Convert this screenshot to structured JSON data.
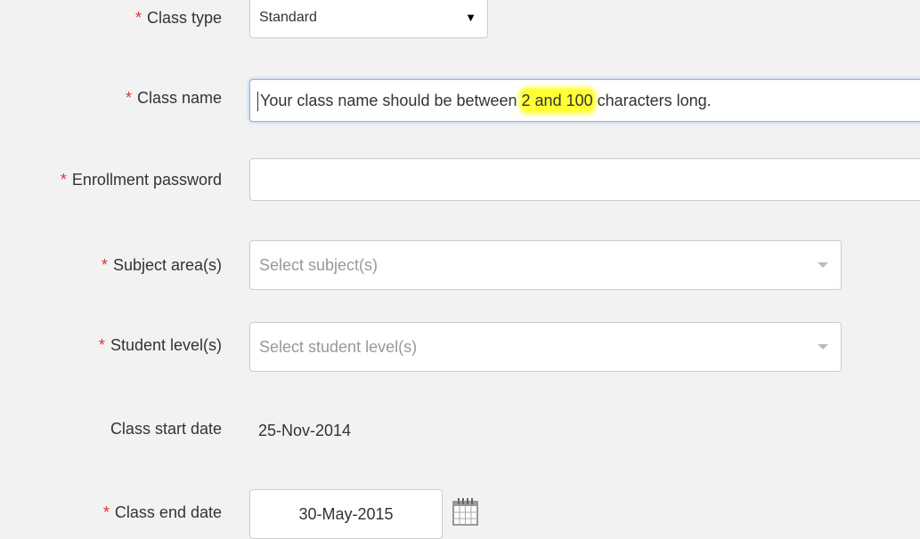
{
  "form": {
    "required_mark": "*",
    "class_type": {
      "label": "Class type",
      "value": "Standard",
      "arrow": "▼"
    },
    "class_name": {
      "label": "Class name",
      "value_before": "Your class name should be between ",
      "value_highlight": "2 and 100",
      "value_after": " characters long."
    },
    "enrollment_password": {
      "label": "Enrollment password",
      "value": ""
    },
    "subject_areas": {
      "label": "Subject area(s)",
      "placeholder": "Select subject(s)"
    },
    "student_levels": {
      "label": "Student level(s)",
      "placeholder": "Select student level(s)"
    },
    "class_start_date": {
      "label": "Class start date",
      "value": "25-Nov-2014"
    },
    "class_end_date": {
      "label": "Class end date",
      "value": "30-May-2015",
      "icon": "calendar-icon"
    }
  },
  "colors": {
    "background": "#f2f2f2",
    "required": "#dd3333",
    "highlight": "#ffff33",
    "focus_border": "#8fb5e6"
  }
}
